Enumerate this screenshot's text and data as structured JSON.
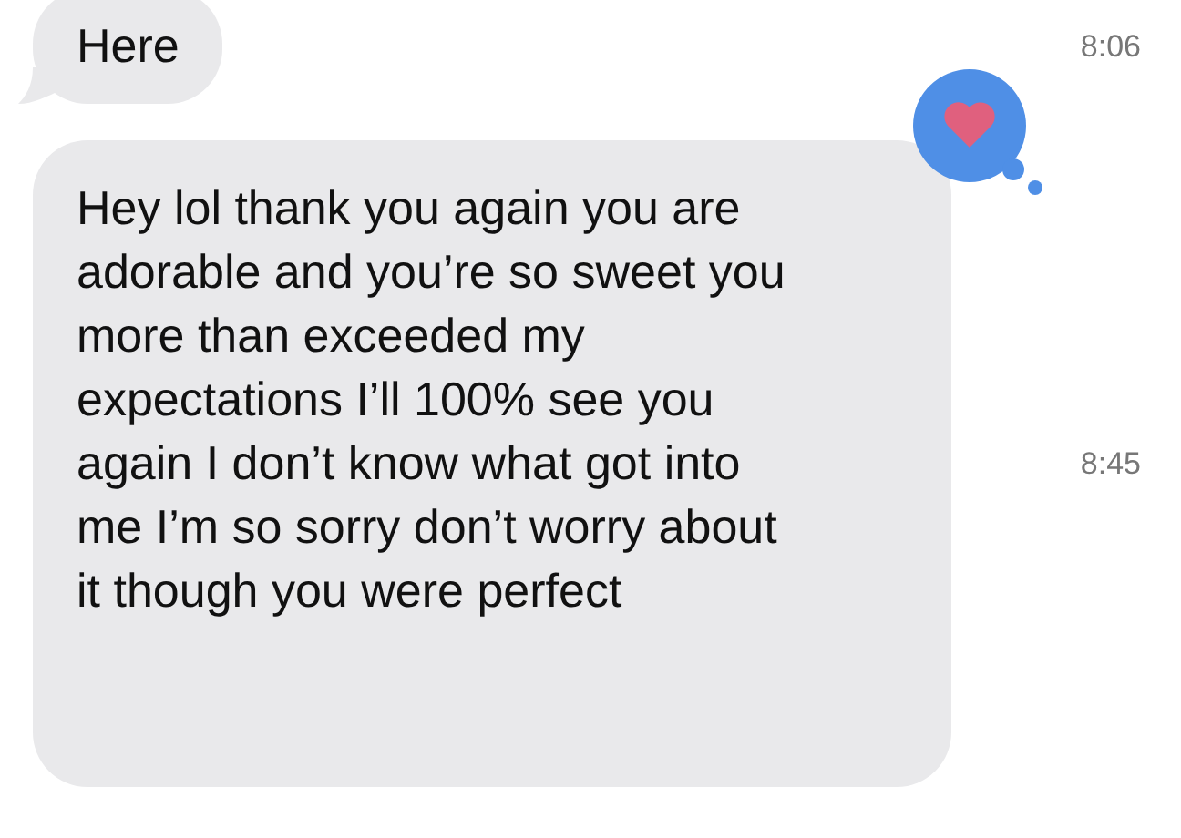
{
  "messages": [
    {
      "text": "Here",
      "time": "8:06",
      "reaction": false
    },
    {
      "text": "Hey lol thank you again you are adorable and you’re so sweet you more than exceeded my expectations I’ll 100% see you again I don’t know what got into me I’m so sorry don’t worry about it though you were perfect",
      "time": "8:45",
      "reaction": true
    }
  ]
}
